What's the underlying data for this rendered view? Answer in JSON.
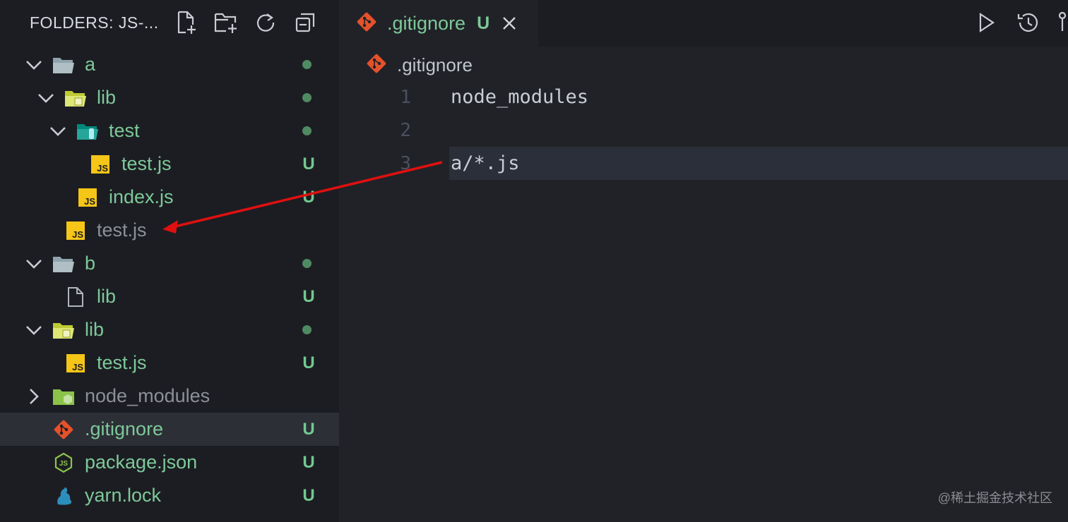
{
  "sidebar": {
    "title": "FOLDERS: JS-...",
    "actions": [
      "new-file-icon",
      "new-folder-icon",
      "refresh-icon",
      "collapse-all-icon"
    ],
    "tree": [
      {
        "label": "a",
        "kind": "folder-open",
        "level": 0,
        "expanded": true,
        "status": "dot",
        "color": "green"
      },
      {
        "label": "lib",
        "kind": "folder-lib-open",
        "level": 1,
        "expanded": true,
        "status": "dot",
        "color": "green"
      },
      {
        "label": "test",
        "kind": "folder-test-open",
        "level": 2,
        "expanded": true,
        "status": "dot",
        "color": "green"
      },
      {
        "label": "test.js",
        "kind": "js",
        "level": 3,
        "status": "U",
        "color": "green"
      },
      {
        "label": "index.js",
        "kind": "js",
        "level": 2,
        "status": "U",
        "color": "green"
      },
      {
        "label": "test.js",
        "kind": "js",
        "level": 1,
        "status": "",
        "color": "grey"
      },
      {
        "label": "b",
        "kind": "folder-open",
        "level": 0,
        "expanded": true,
        "status": "dot",
        "color": "green"
      },
      {
        "label": "lib",
        "kind": "file",
        "level": 1,
        "status": "U",
        "color": "green"
      },
      {
        "label": "lib",
        "kind": "folder-lib-open",
        "level": 0,
        "expanded": true,
        "status": "dot",
        "color": "green"
      },
      {
        "label": "test.js",
        "kind": "js",
        "level": 1,
        "status": "U",
        "color": "green"
      },
      {
        "label": "node_modules",
        "kind": "folder-node",
        "level": 0,
        "expanded": false,
        "status": "",
        "color": "grey"
      },
      {
        "label": ".gitignore",
        "kind": "git",
        "level": 0,
        "status": "U",
        "color": "green",
        "selected": true
      },
      {
        "label": "package.json",
        "kind": "node",
        "level": 0,
        "status": "U",
        "color": "green"
      },
      {
        "label": "yarn.lock",
        "kind": "yarn",
        "level": 0,
        "status": "U",
        "color": "green"
      }
    ]
  },
  "editor": {
    "tab": {
      "name": ".gitignore",
      "status": "U",
      "icon": "git-icon"
    },
    "run_actions": [
      "run-icon",
      "history-icon",
      "compare-icon"
    ],
    "breadcrumb": ".gitignore",
    "lines": [
      {
        "num": "1",
        "text": "node_modules"
      },
      {
        "num": "2",
        "text": ""
      },
      {
        "num": "3",
        "text": "a/*.js",
        "current": true
      }
    ]
  },
  "watermark": "@稀土掘金技术社区",
  "colors": {
    "accent_green": "#7dc99a",
    "git_orange": "#e4512b",
    "js_yellow": "#f5c518",
    "arrow_red": "#e01010"
  }
}
